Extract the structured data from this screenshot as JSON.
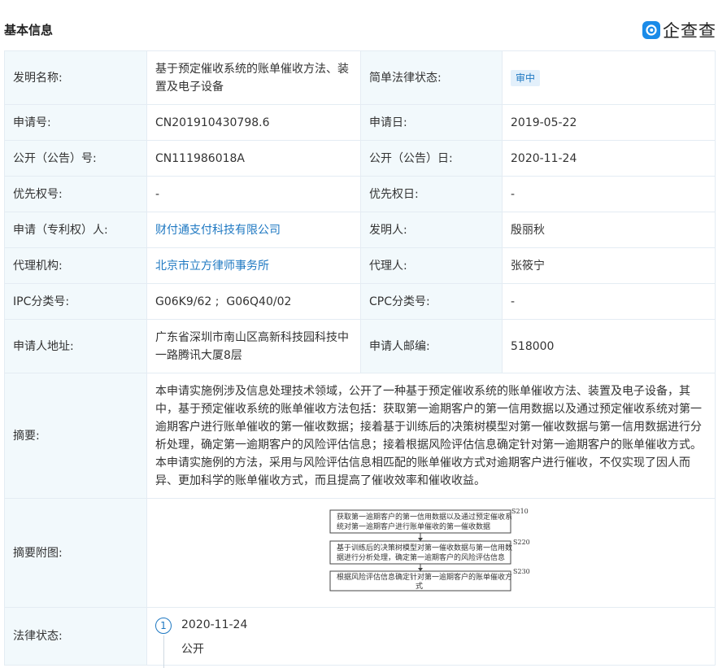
{
  "header": {
    "title": "基本信息",
    "logo_text": "企查查"
  },
  "rows": {
    "invention_name": {
      "label": "发明名称:",
      "value": "基于预定催收系统的账单催收方法、装置及电子设备"
    },
    "legal_status_simple": {
      "label": "简单法律状态:",
      "value": "审中"
    },
    "app_no": {
      "label": "申请号:",
      "value": "CN201910430798.6"
    },
    "app_date": {
      "label": "申请日:",
      "value": "2019-05-22"
    },
    "pub_no": {
      "label": "公开（公告）号:",
      "value": "CN111986018A"
    },
    "pub_date": {
      "label": "公开（公告）日:",
      "value": "2020-11-24"
    },
    "priority_no": {
      "label": "优先权号:",
      "value": "-"
    },
    "priority_date": {
      "label": "优先权日:",
      "value": "-"
    },
    "applicant": {
      "label": "申请（专利权）人:",
      "value": "财付通支付科技有限公司"
    },
    "inventor": {
      "label": "发明人:",
      "value": "殷丽秋"
    },
    "agency": {
      "label": "代理机构:",
      "value": "北京市立方律师事务所"
    },
    "agent": {
      "label": "代理人:",
      "value": "张筱宁"
    },
    "ipc": {
      "label": "IPC分类号:",
      "value": "G06K9/62 ;  G06Q40/02"
    },
    "cpc": {
      "label": "CPC分类号:",
      "value": "-"
    },
    "address": {
      "label": "申请人地址:",
      "value": "广东省深圳市南山区高新科技园科技中一路腾讯大厦8层"
    },
    "postcode": {
      "label": "申请人邮编:",
      "value": "518000"
    },
    "abstract": {
      "label": "摘要:",
      "value": "本申请实施例涉及信息处理技术领域，公开了一种基于预定催收系统的账单催收方法、装置及电子设备，其中，基于预定催收系统的账单催收方法包括：获取第一逾期客户的第一信用数据以及通过预定催收系统对第一逾期客户进行账单催收的第一催收数据；接着基于训练后的决策树模型对第一催收数据与第一信用数据进行分析处理，确定第一逾期客户的风险评估信息；接着根据风险评估信息确定针对第一逾期客户的账单催收方式。本申请实施例的方法，采用与风险评估信息相匹配的账单催收方式对逾期客户进行催收，不仅实现了因人而异、更加科学的账单催收方式，而且提高了催收效率和催收收益。"
    },
    "abstract_figure": {
      "label": "摘要附图:",
      "steps": [
        {
          "id": "S210",
          "line1": "获取第一逾期客户的第一信用数据以及通过预定催收系",
          "line2": "统对第一逾期客户进行账单催收的第一催收数据"
        },
        {
          "id": "S220",
          "line1": "基于训练后的决策树模型对第一催收数据与第一信用数",
          "line2": "据进行分析处理，确定第一逾期客户的风险评估信息"
        },
        {
          "id": "S230",
          "line1": "根据风险评估信息确定针对第一逾期客户的账单催收方",
          "line2": "式"
        }
      ]
    },
    "legal_status": {
      "label": "法律状态:",
      "index": "1",
      "date": "2020-11-24",
      "status": "公开"
    }
  },
  "colors": {
    "label_bg": "#f2f9fc",
    "link": "#1e78c2",
    "border": "#e4ecf3",
    "logo": "#1a8be8"
  }
}
